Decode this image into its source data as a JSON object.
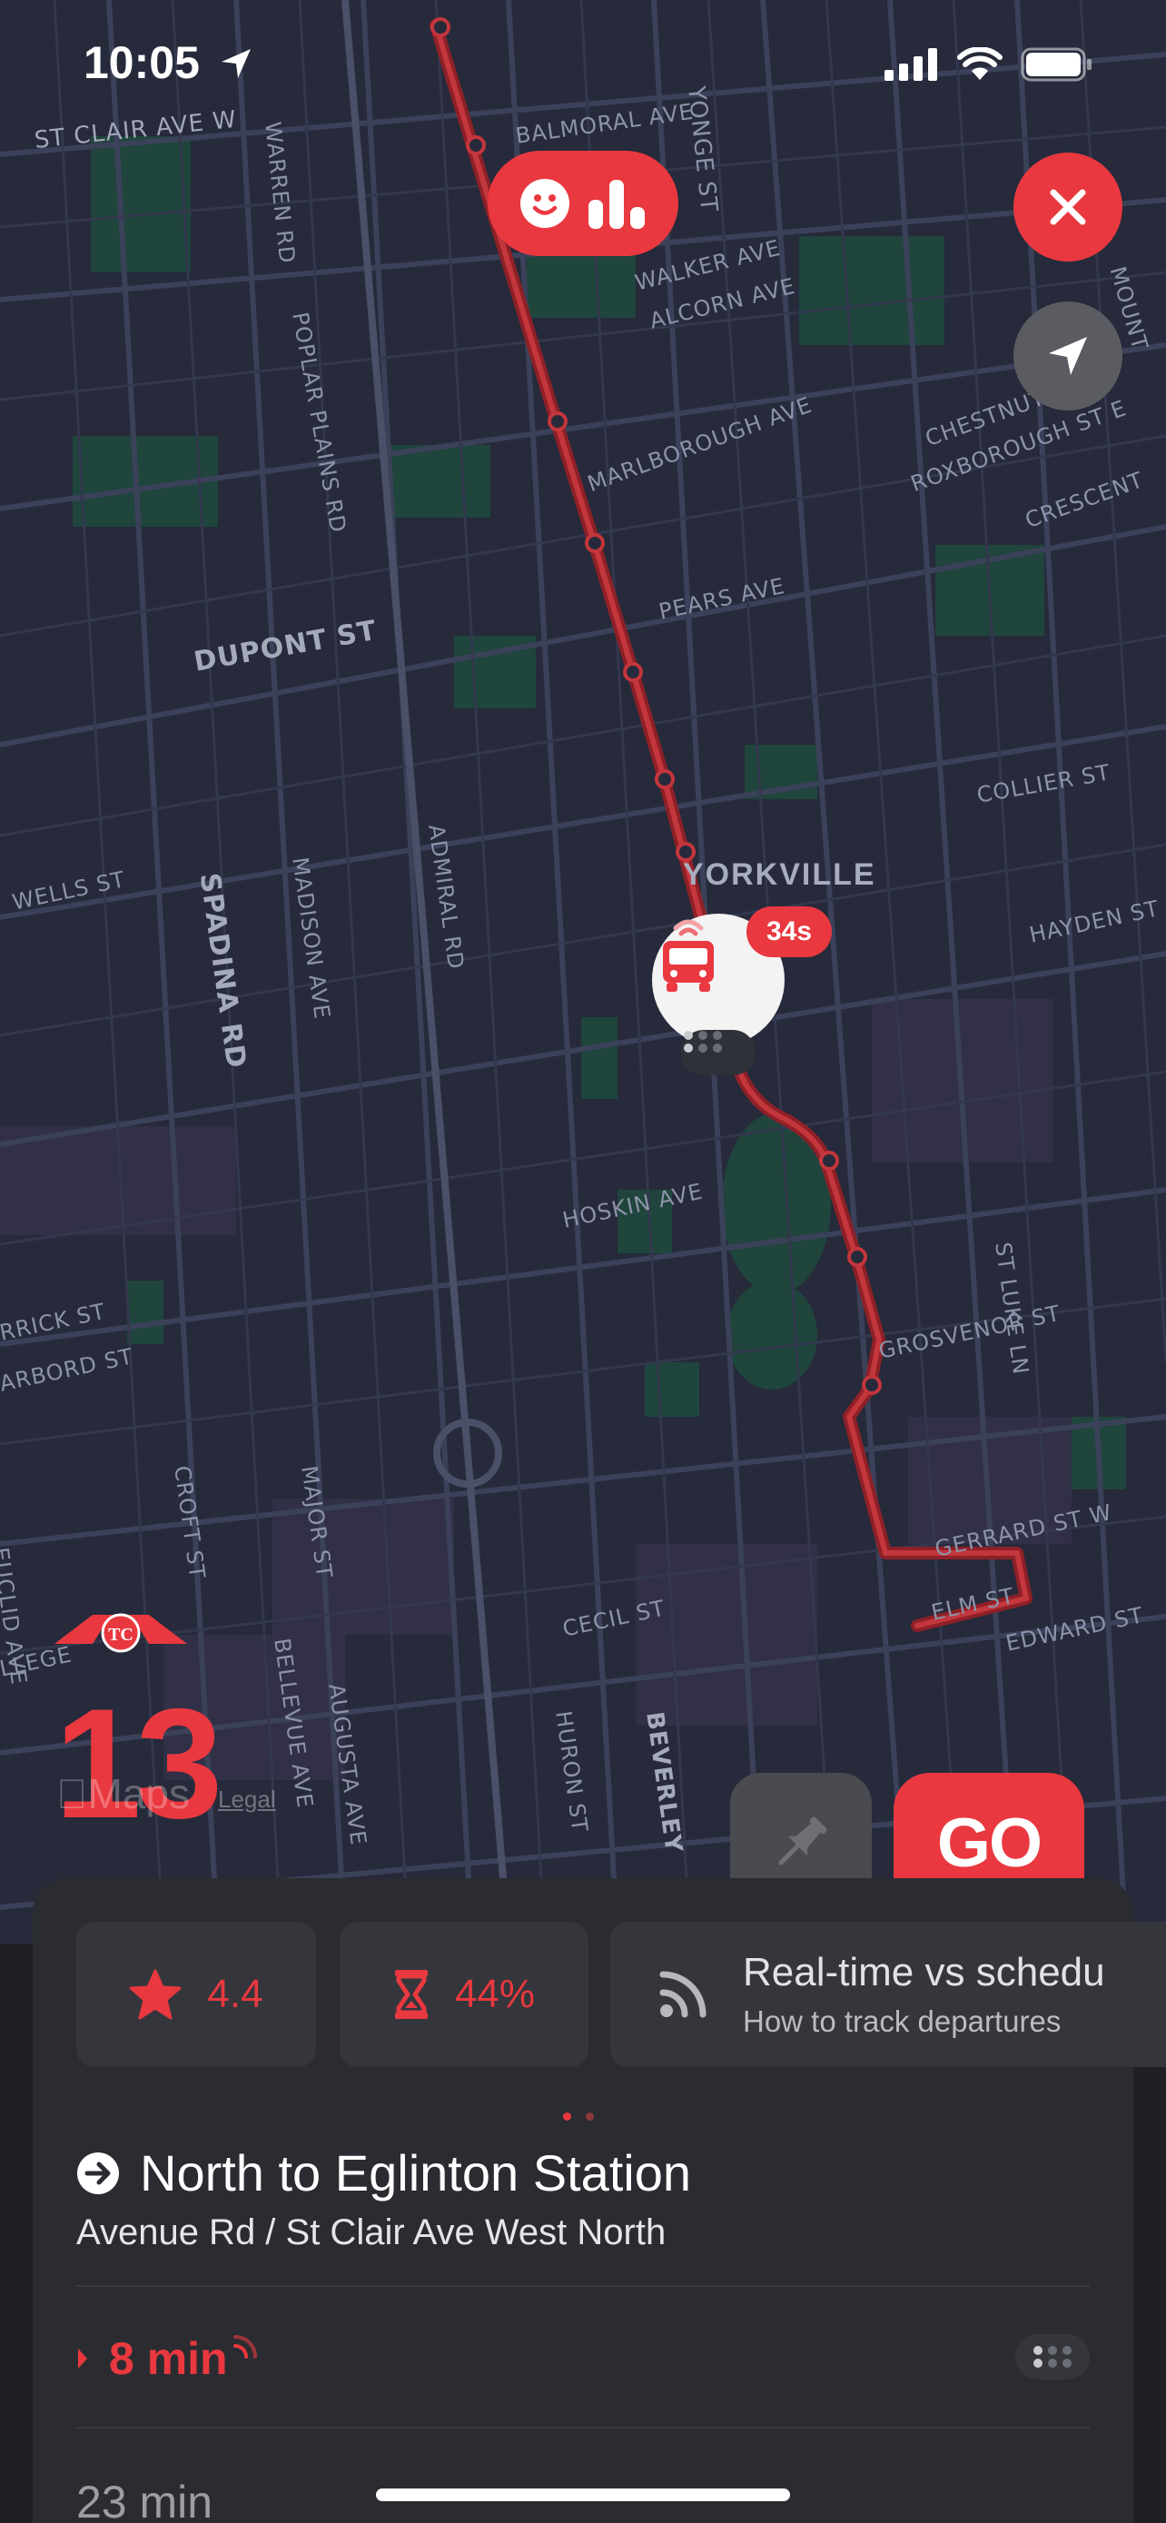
{
  "status_bar": {
    "time": "10:05"
  },
  "colors": {
    "accent": "#e9383f",
    "map_bg": "#262a3a",
    "route_line": "#b5292f",
    "sheet_bg": "#2b2c31"
  },
  "map": {
    "streets": [
      {
        "name": "ST CLAIR AVE W"
      },
      {
        "name": "WARREN RD"
      },
      {
        "name": "BALMORAL AVE"
      },
      {
        "name": "POPLAR PLAINS RD"
      },
      {
        "name": "YONGE ST"
      },
      {
        "name": "WALKER AVE"
      },
      {
        "name": "ALCORN AVE"
      },
      {
        "name": "MARLBOROUGH AVE"
      },
      {
        "name": "CHESTNUT"
      },
      {
        "name": "ROXBOROUGH ST E"
      },
      {
        "name": "CRESCENT"
      },
      {
        "name": "MOUNT"
      },
      {
        "name": "PEARS AVE"
      },
      {
        "name": "DUPONT ST"
      },
      {
        "name": "SPADINA RD"
      },
      {
        "name": "MADISON AVE"
      },
      {
        "name": "ADMIRAL RD"
      },
      {
        "name": "COLLIER ST"
      },
      {
        "name": "WELLS ST"
      },
      {
        "name": "HAYDEN ST"
      },
      {
        "name": "HOSKIN AVE"
      },
      {
        "name": "ST LUKE LN"
      },
      {
        "name": "GROSVENOR ST"
      },
      {
        "name": "RRICK ST"
      },
      {
        "name": "ARBORD ST"
      },
      {
        "name": "CROFT ST"
      },
      {
        "name": "MAJOR ST"
      },
      {
        "name": "EUCLID AVE"
      },
      {
        "name": "GERRARD ST W"
      },
      {
        "name": "ELM ST"
      },
      {
        "name": "EDWARD ST"
      },
      {
        "name": "LLEGE"
      },
      {
        "name": "BELLEVUE AVE"
      },
      {
        "name": "AUGUSTA AVE"
      },
      {
        "name": "CECIL ST"
      },
      {
        "name": "HURON ST"
      },
      {
        "name": "BEVERLEY"
      }
    ],
    "neighborhood": "YORKVILLE",
    "vehicle_badge": "34s",
    "attribution": "Maps",
    "legal": "Legal"
  },
  "top_controls": {
    "close_icon": "close-icon",
    "locate_icon": "location-arrow-icon",
    "pill_icons": [
      "smiley-icon",
      "bar-chart-icon"
    ]
  },
  "route": {
    "number": "13",
    "logo": "ttc-logo"
  },
  "actions": {
    "go_label": "GO",
    "pin_icon": "pin-icon"
  },
  "chips": {
    "rating": "4.4",
    "percent": "44%",
    "rt_title": "Real-time vs schedu",
    "rt_subtitle": "How to track departures"
  },
  "direction": {
    "title": "North to Eglinton Station",
    "stop": "Avenue Rd / St Clair Ave West North"
  },
  "departures": [
    {
      "time": "8 min",
      "realtime": true
    },
    {
      "time": "23 min",
      "realtime": false
    }
  ]
}
